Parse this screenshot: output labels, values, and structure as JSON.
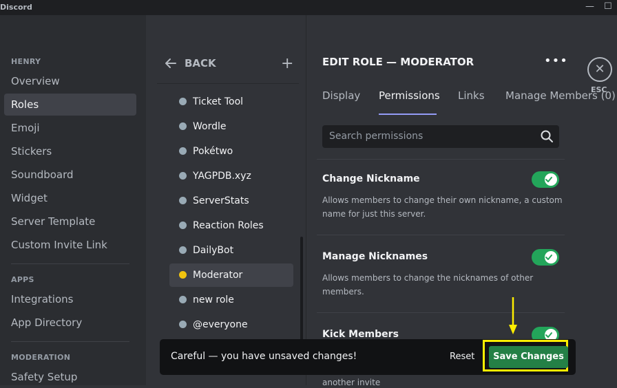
{
  "titlebar": {
    "title": "Discord",
    "minimize": "—",
    "maximize": "☐"
  },
  "sidebar": {
    "server_heading": "HENRY",
    "items": [
      "Overview",
      "Roles",
      "Emoji",
      "Stickers",
      "Soundboard",
      "Widget",
      "Server Template",
      "Custom Invite Link"
    ],
    "active_item": "Roles",
    "apps_heading": "APPS",
    "apps_items": [
      "Integrations",
      "App Directory"
    ],
    "moderation_heading": "MODERATION",
    "moderation_items": [
      "Safety Setup"
    ]
  },
  "rolelist": {
    "back_label": "BACK",
    "roles": [
      "Ticket Tool",
      "Wordle",
      "Pokétwo",
      "YAGPDB.xyz",
      "ServerStats",
      "Reaction Roles",
      "DailyBot",
      "Moderator",
      "new role",
      "@everyone"
    ],
    "active_role": "Moderator"
  },
  "main": {
    "title": "EDIT ROLE — MODERATOR",
    "esc_label": "ESC",
    "tabs": [
      "Display",
      "Permissions",
      "Links",
      "Manage Members (0)"
    ],
    "active_tab": "Permissions",
    "search_placeholder": "Search permissions",
    "permissions": [
      {
        "name": "Change Nickname",
        "description": "Allows members to change their own nickname, a custom name for just this server.",
        "enabled": true
      },
      {
        "name": "Manage Nicknames",
        "description": "Allows members to change the nicknames of other members.",
        "enabled": true
      },
      {
        "name": "Kick Members",
        "description": "",
        "enabled": true
      }
    ],
    "bottom_peek_text": "another invite"
  },
  "unsaved_bar": {
    "message": "Careful — you have unsaved changes!",
    "reset_label": "Reset",
    "save_label": "Save Changes"
  },
  "colors": {
    "accent": "#949cf7",
    "toggle_on": "#23a55a",
    "save": "#248046",
    "highlight": "#ffee00",
    "moderator": "#f1c40f"
  }
}
